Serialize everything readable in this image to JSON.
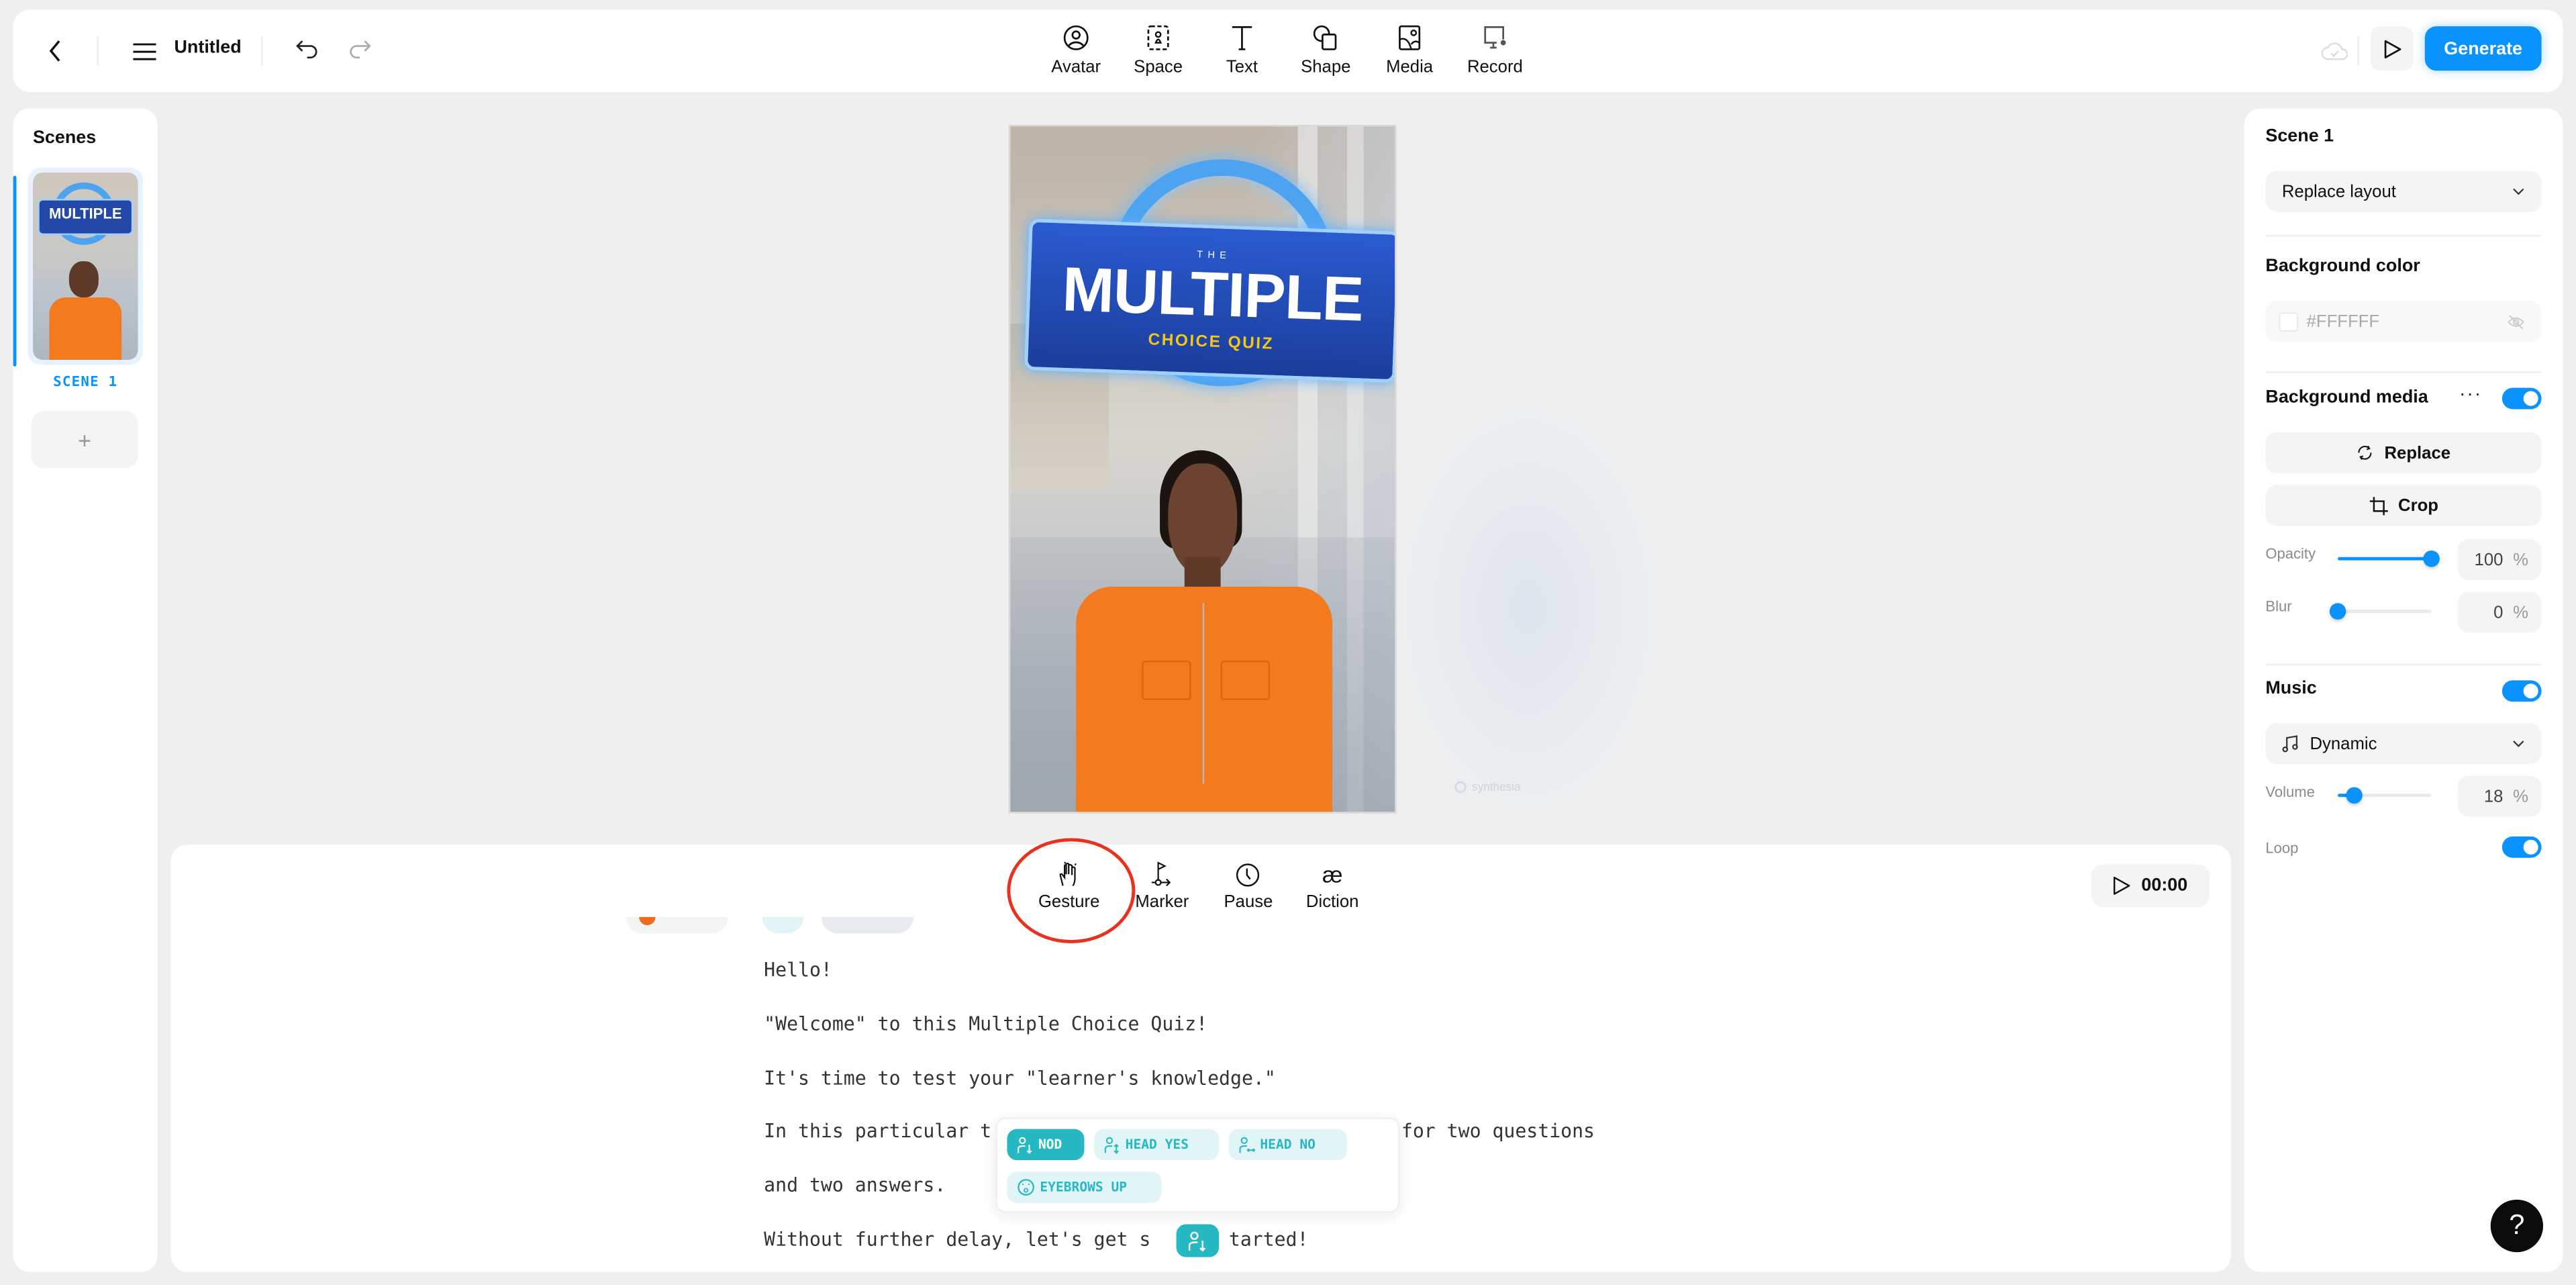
{
  "topbar": {
    "doc_title": "Untitled",
    "tools": [
      {
        "label": "Avatar",
        "icon": "avatar-icon"
      },
      {
        "label": "Space",
        "icon": "space-icon"
      },
      {
        "label": "Text",
        "icon": "text-icon"
      },
      {
        "label": "Shape",
        "icon": "shape-icon"
      },
      {
        "label": "Media",
        "icon": "media-icon"
      },
      {
        "label": "Record",
        "icon": "record-icon"
      }
    ],
    "generate_label": "Generate"
  },
  "scenes": {
    "title": "Scenes",
    "items": [
      {
        "label": "SCENE 1",
        "active": true
      }
    ],
    "add_label": "+"
  },
  "canvas": {
    "sign_the": "THE",
    "sign_main": "MULTIPLE",
    "sign_sub": "CHOICE QUIZ",
    "watermark": "synthesia"
  },
  "editor": {
    "tools": [
      {
        "label": "Gesture",
        "icon": "gesture-hand-icon",
        "highlighted": true
      },
      {
        "label": "Marker",
        "icon": "marker-flag-icon"
      },
      {
        "label": "Pause",
        "icon": "clock-icon"
      },
      {
        "label": "Diction",
        "icon": "diction-ae-icon"
      }
    ],
    "play_time": "00:00",
    "script_lines": [
      "Hello!",
      "\"Welcome\" to this Multiple Choice Quiz!",
      "It's time to test your \"learner's knowledge.\"",
      "In this particular t",
      "and two answers.",
      "Without further delay, let's get s"
    ],
    "line4_tail": "for two questions",
    "line6_tail": "tarted!",
    "gesture_options": [
      {
        "label": "NOD",
        "active": true
      },
      {
        "label": "HEAD YES",
        "active": false
      },
      {
        "label": "HEAD NO",
        "active": false
      },
      {
        "label": "EYEBROWS UP",
        "active": false
      }
    ]
  },
  "props": {
    "scene_title": "Scene 1",
    "layout_select": "Replace layout",
    "bg_color_label": "Background color",
    "bg_color_value": "#FFFFFF",
    "bg_media_label": "Background media",
    "bg_media_enabled": true,
    "replace_label": "Replace",
    "crop_label": "Crop",
    "opacity_label": "Opacity",
    "opacity_value": "100",
    "blur_label": "Blur",
    "blur_value": "0",
    "percent": "%",
    "music_label": "Music",
    "music_enabled": true,
    "music_track": "Dynamic",
    "volume_label": "Volume",
    "volume_value": "18",
    "loop_label": "Loop",
    "loop_enabled": true
  },
  "help_label": "?",
  "colors": {
    "accent": "#0a93ff",
    "gesture_teal": "#26b9c3",
    "annotation_red": "#e8321f"
  }
}
